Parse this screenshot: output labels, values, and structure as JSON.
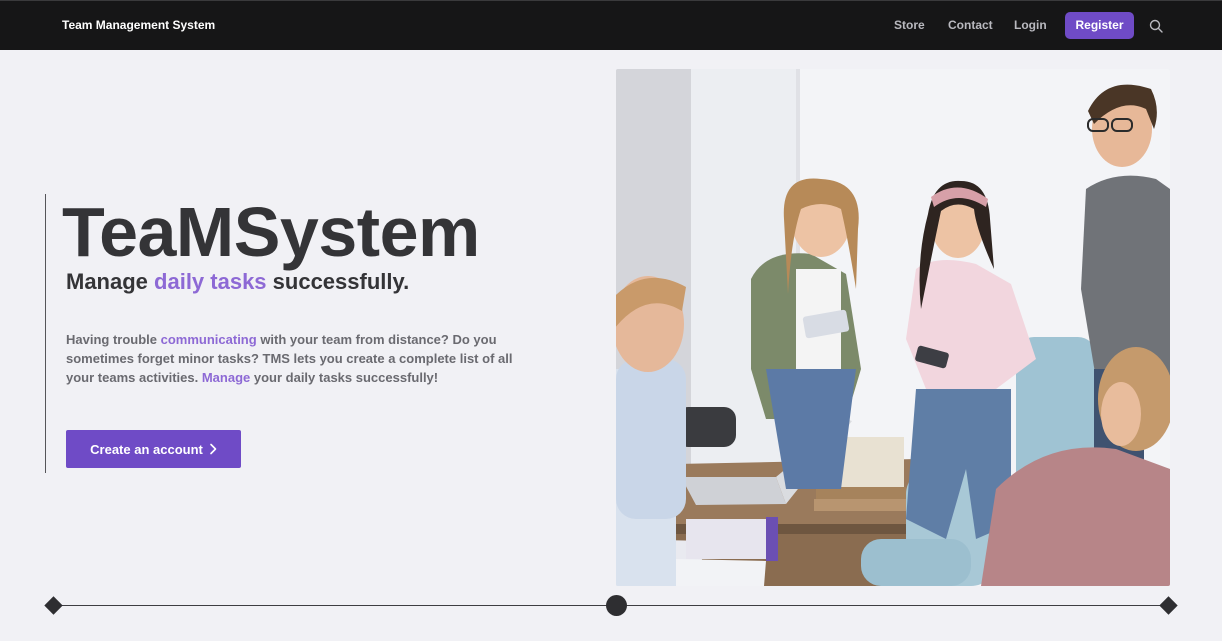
{
  "navbar": {
    "brand": "Team Management System",
    "links": [
      "Store",
      "Contact",
      "Login"
    ],
    "register_label": "Register",
    "search_icon": "search-icon"
  },
  "hero": {
    "title": "TeaMSystem",
    "subtitle_pre": "Manage ",
    "subtitle_accent": "daily tasks",
    "subtitle_post": " successfully.",
    "desc_1": "Having trouble ",
    "desc_accent_1": "communicating",
    "desc_2": " with your team from distance? Do you sometimes forget minor tasks? TMS lets you create a complete list of all your teams activities. ",
    "desc_accent_2": "Manage",
    "desc_3": " your daily tasks successfully!",
    "cta_label": "Create an account",
    "cta_icon": "chevron-right-icon"
  },
  "photo": {
    "icon": "team-photo"
  },
  "colors": {
    "accent": "#6f4bc6",
    "accent_text": "#8d69d5",
    "navbar_bg": "#161617",
    "page_bg": "#f1f1f5"
  }
}
